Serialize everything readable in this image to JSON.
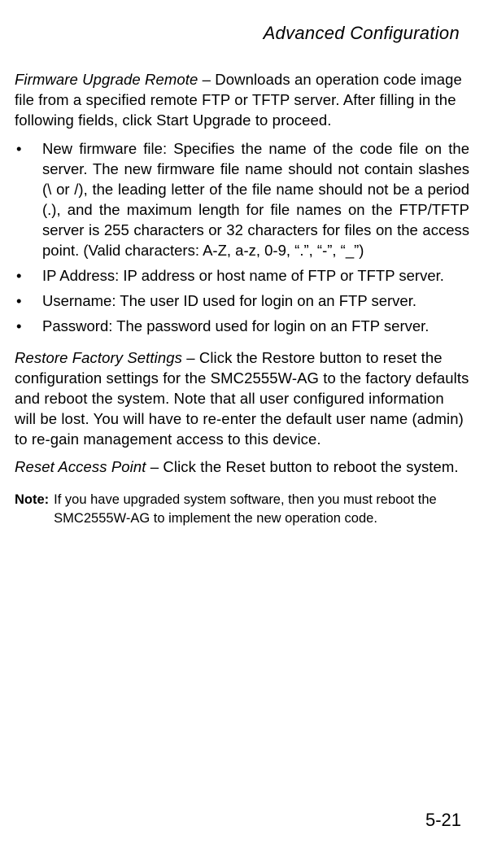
{
  "header": {
    "title": "Advanced Configuration"
  },
  "sections": {
    "firmware": {
      "label": "Firmware Upgrade Remote",
      "text": " – Downloads an operation code image file from a specified remote FTP or TFTP server. After filling in the following fields, click Start Upgrade to proceed."
    },
    "bullets": [
      "New firmware file: Specifies the name of the code file on the server. The new firmware file name should not contain slashes (\\ or /), the leading letter of the file name should not be a period (.), and the maximum length for file names on the FTP/TFTP server is 255 characters or 32 characters for files on the access point. (Valid characters: A-Z, a-z, 0-9, “.”, “-”, “_”)",
      "IP Address: IP address or host name of FTP or TFTP server.",
      "Username: The user ID used for login on an FTP server.",
      "Password: The password used for login on an FTP server."
    ],
    "restore": {
      "label": "Restore Factory Settings",
      "text": " – Click the Restore button to reset the configuration settings for the SMC2555W-AG to the factory defaults and reboot the system. Note that all user configured information will be lost. You will have to re-enter the default user name (admin) to re-gain management access to this device."
    },
    "reset": {
      "label": "Reset Access Point",
      "text": " – Click the Reset button to reboot the system."
    },
    "note": {
      "label": "Note:",
      "text": "If you have upgraded system software, then you must reboot the SMC2555W-AG to implement the new operation code."
    }
  },
  "footer": {
    "page_number": "5-21"
  }
}
